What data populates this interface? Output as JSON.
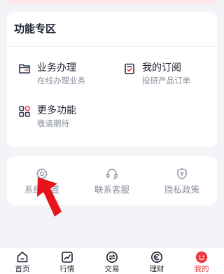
{
  "function_area": {
    "title": "功能专区",
    "items": [
      {
        "label": "业务办理",
        "sub": "在线办理业务",
        "icon": "folder-icon"
      },
      {
        "label": "我的订阅",
        "sub": "投研产品订单",
        "icon": "subscription-icon"
      },
      {
        "label": "更多功能",
        "sub": "敬请期待",
        "icon": "grid-icon"
      }
    ]
  },
  "services": [
    {
      "label": "系统设置",
      "icon": "gear-icon"
    },
    {
      "label": "联系客服",
      "icon": "headset-icon"
    },
    {
      "label": "隐私政策",
      "icon": "shield-icon"
    }
  ],
  "tabbar": {
    "active": "我的",
    "tabs": [
      {
        "label": "首页",
        "icon": "home-icon"
      },
      {
        "label": "行情",
        "icon": "chart-icon"
      },
      {
        "label": "交易",
        "icon": "exchange-icon"
      },
      {
        "label": "理财",
        "icon": "wealth-icon"
      },
      {
        "label": "我的",
        "icon": "profile-icon"
      }
    ]
  },
  "colors": {
    "accent": "#ee3a43",
    "icon_navy": "#2b3150",
    "secondary_text": "#8a8f9c",
    "background": "#f3f4f8"
  }
}
